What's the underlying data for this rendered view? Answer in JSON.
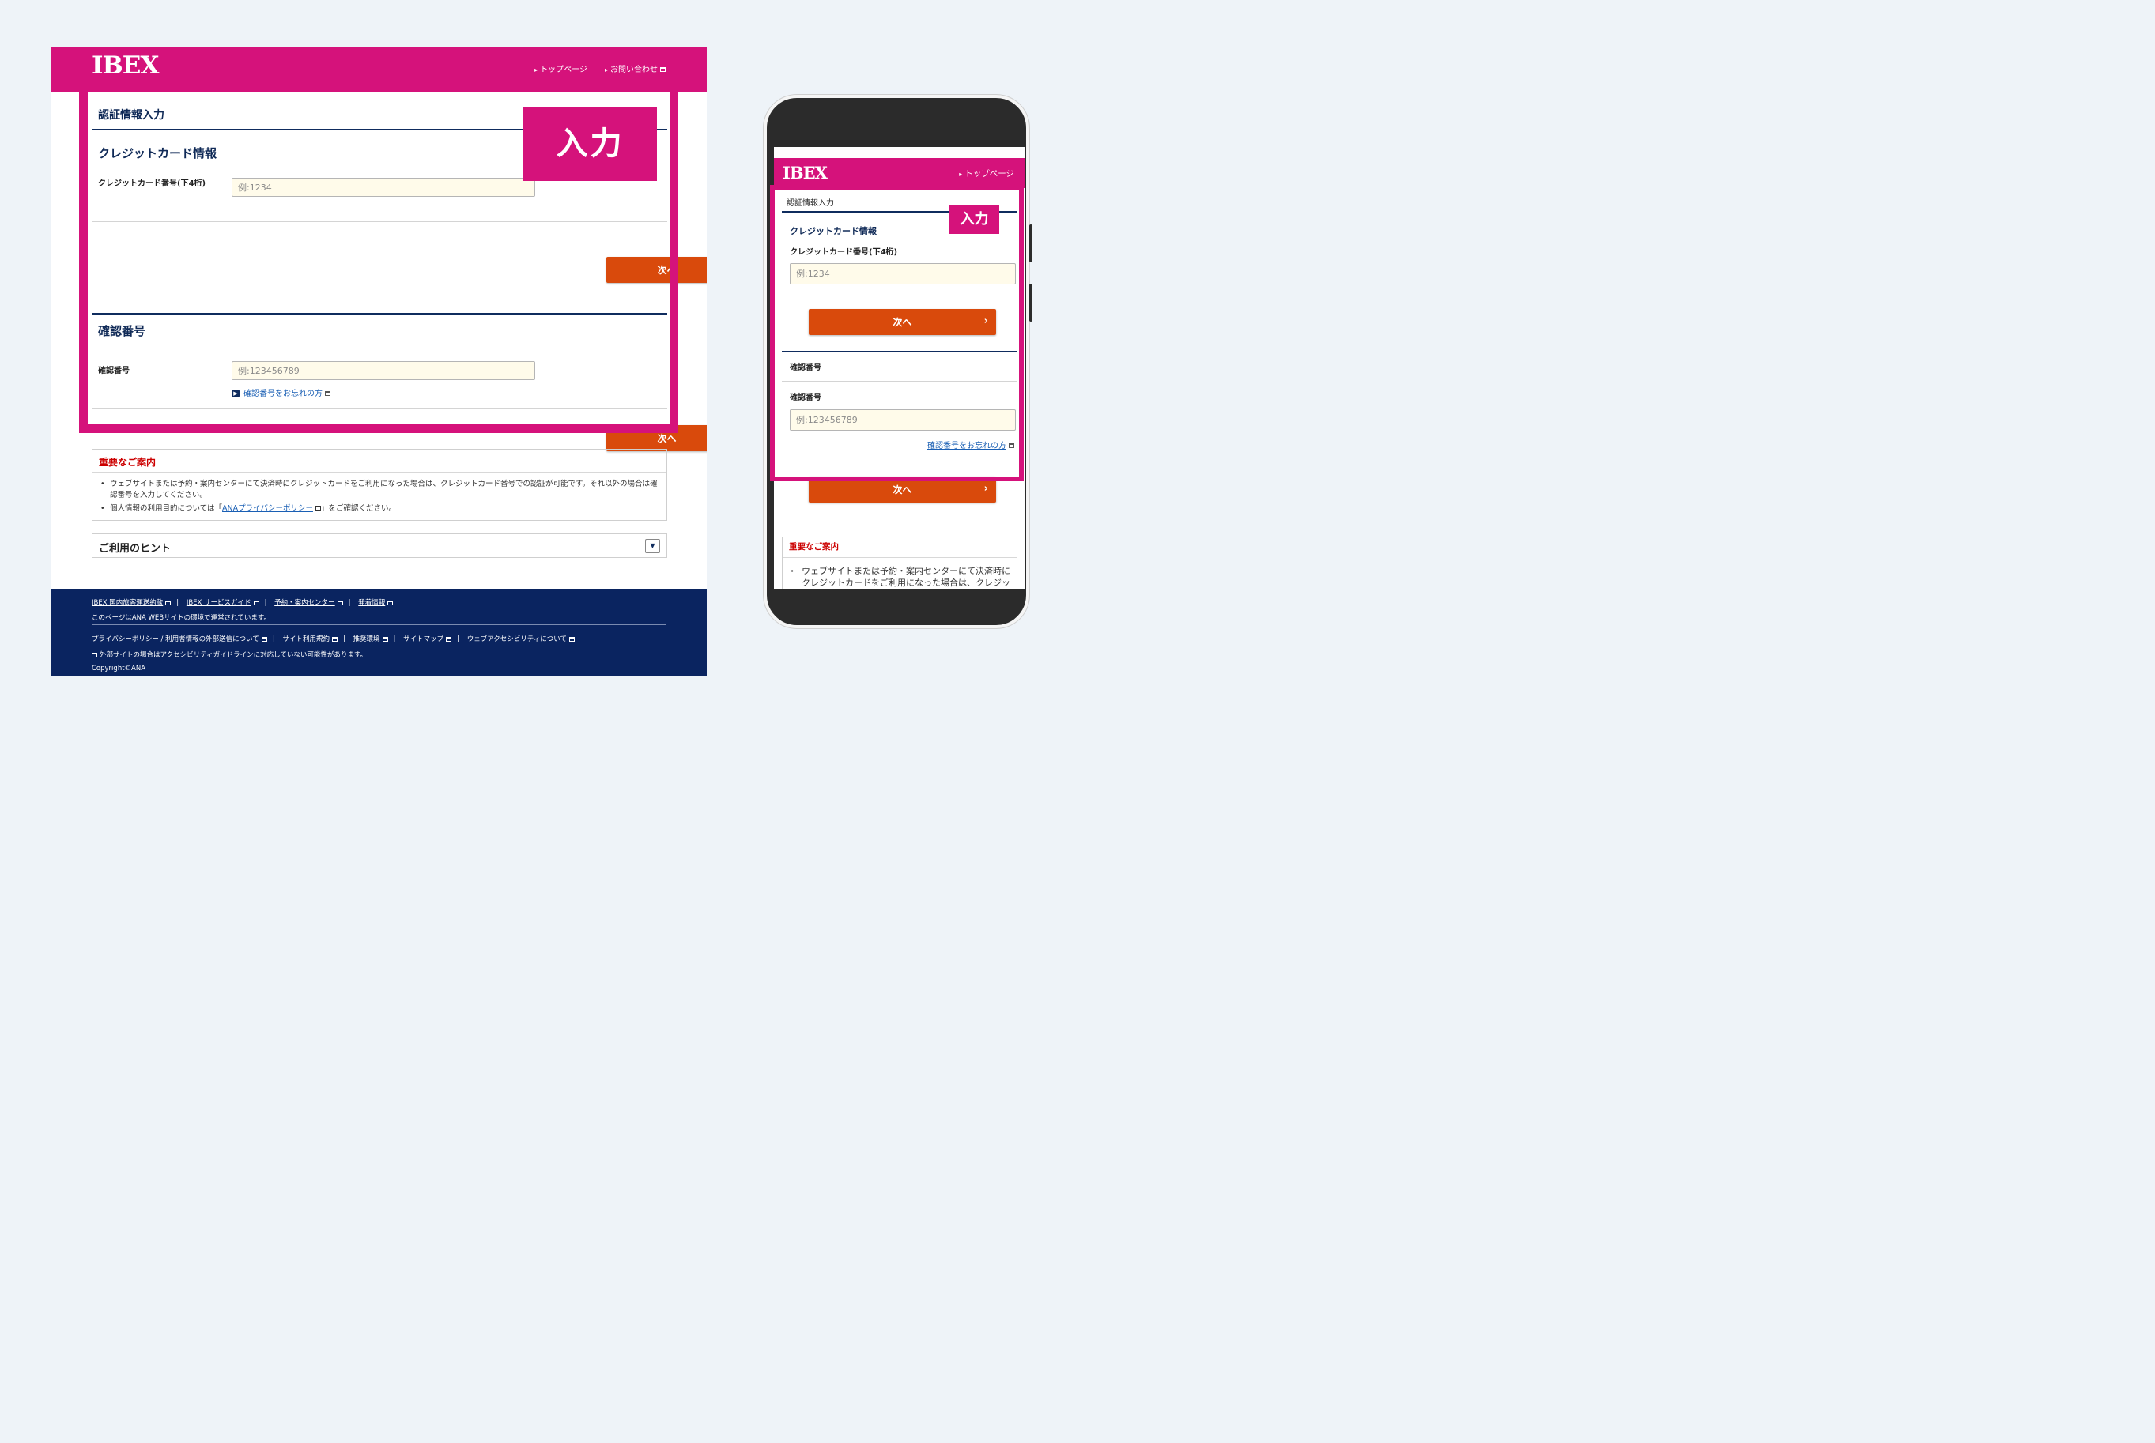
{
  "brand": {
    "logo": "IBEX",
    "accent": "#d5127b",
    "navy": "#0a2460",
    "button": "#d94a0c"
  },
  "header": {
    "nav": [
      "トップページ",
      "お問い合わせ"
    ]
  },
  "form": {
    "section_title": "認証情報入力",
    "card_heading": "クレジットカード情報",
    "card_label": "クレジットカード番号(下4桁)",
    "card_placeholder": "例:1234",
    "next_label": "次へ",
    "confirm_heading": "確認番号",
    "confirm_label": "確認番号",
    "confirm_placeholder": "例:123456789",
    "forgot_link": "確認番号をお忘れの方"
  },
  "badge": "入力",
  "notice": {
    "heading": "重要なご案内",
    "items": [
      "ウェブサイトまたは予約・案内センターにて決済時にクレジットカードをご利用になった場合は、クレジットカード番号での認証が可能です。それ以外の場合は確認番号を入力してください。",
      "個人情報の利用目的については「",
      "ANAプライバシーポリシー",
      "」をご確認ください。"
    ]
  },
  "hints": {
    "label": "ご利用のヒント"
  },
  "footer": {
    "links1": [
      "IBEX 国内旅客運送約款",
      "IBEX サービスガイド",
      "予約・案内センター",
      "発着情報"
    ],
    "env_note": "このページはANA WEBサイトの環境で運営されています。",
    "links2": [
      "プライバシーポリシー / 利用者情報の外部送信について",
      "サイト利用規約",
      "推奨環境",
      "サイトマップ",
      "ウェブアクセシビリティについて"
    ],
    "ext_note": "外部サイトの場合はアクセシビリティガイドラインに対応していない可能性があります。",
    "copyright": "Copyright©ANA"
  },
  "mobile": {
    "nav": "トップページ",
    "notice_text": "ウェブサイトまたは予約・案内センターにて決済時にクレジットカードをご利用になった場合は、クレジットカード番号での認証が可能です。それ以外の場合は確認番号を入力してください。"
  }
}
